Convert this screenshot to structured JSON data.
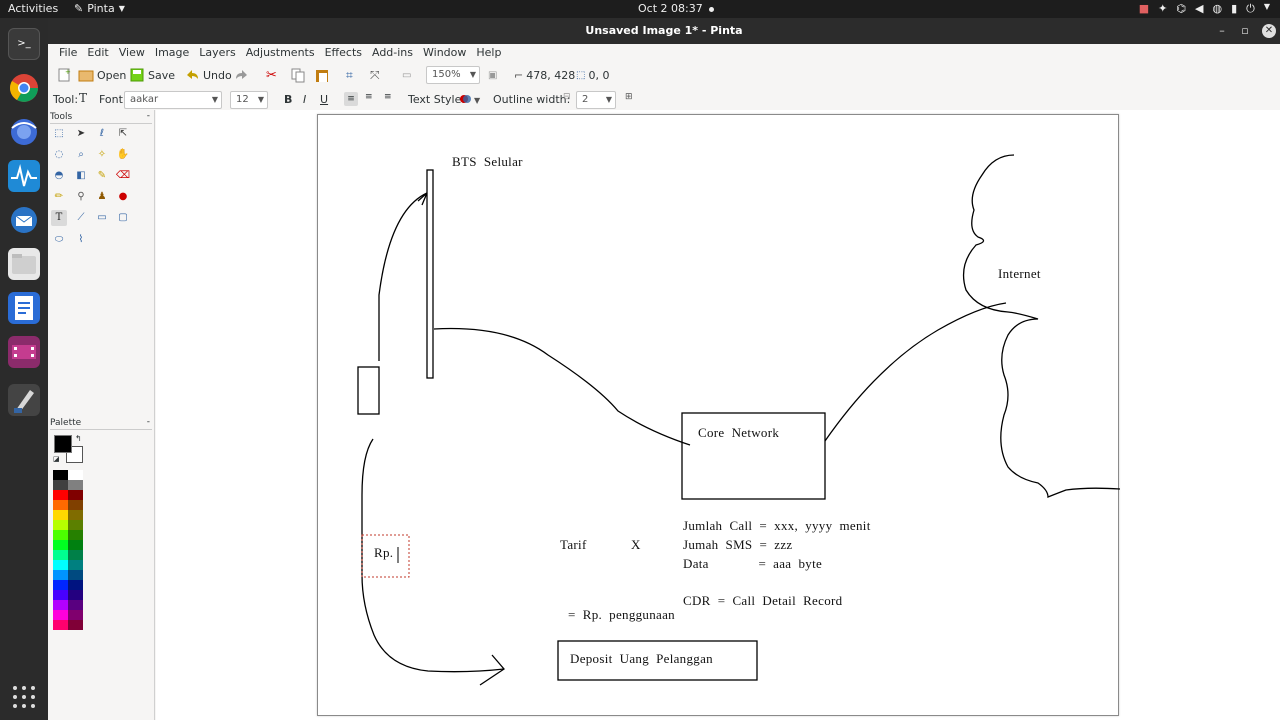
{
  "topbar": {
    "activities": "Activities",
    "app_name": "Pinta",
    "clock": "Oct 2  08:37"
  },
  "window": {
    "title": "Unsaved Image 1* - Pinta"
  },
  "menu": [
    "File",
    "Edit",
    "View",
    "Image",
    "Layers",
    "Adjustments",
    "Effects",
    "Add-ins",
    "Window",
    "Help"
  ],
  "toolbar": {
    "open_label": "Open",
    "save_label": "Save",
    "undo_label": "Undo",
    "zoom_value": "150%",
    "cursor_position": "478, 428",
    "selection_size": "0, 0"
  },
  "text_toolbar": {
    "tool_label": "Tool:",
    "font_label": "Font:",
    "font_value": "aakar",
    "font_size": "12",
    "bold": "B",
    "italic": "I",
    "underline": "U",
    "text_style_label": "Text Style:",
    "outline_width_label": "Outline width:",
    "outline_width_value": "2"
  },
  "panels": {
    "tools_title": "Tools",
    "palette_title": "Palette"
  },
  "palette_colors": [
    "#000000",
    "#ffffff",
    "#404040",
    "#808080",
    "#ff0000",
    "#800000",
    "#ff6a00",
    "#804000",
    "#ffd800",
    "#806c00",
    "#b6ff00",
    "#5b8000",
    "#4cff00",
    "#268000",
    "#00ff21",
    "#008010",
    "#00ff90",
    "#008048",
    "#00ffff",
    "#008080",
    "#0094ff",
    "#004a80",
    "#0026ff",
    "#001380",
    "#4800ff",
    "#240080",
    "#b200ff",
    "#590080",
    "#ff00dc",
    "#80006e",
    "#ff006e",
    "#800037"
  ],
  "drawing": {
    "bts_label": "BTS  Selular",
    "internet_label": "Internet",
    "core_network_label": "Core  Network",
    "rp_text": "Rp.",
    "tarif_label": "Tarif",
    "times_label": "X",
    "line1": "Jumlah  Call  =  xxx,  yyyy  menit",
    "line2": "Jumah  SMS  =  zzz",
    "line3": "Data              =  aaa  byte",
    "cdr_line": "CDR  =  Call  Detail  Record",
    "result_line": "=  Rp.  penggunaan",
    "deposit_label": "Deposit  Uang  Pelanggan"
  }
}
